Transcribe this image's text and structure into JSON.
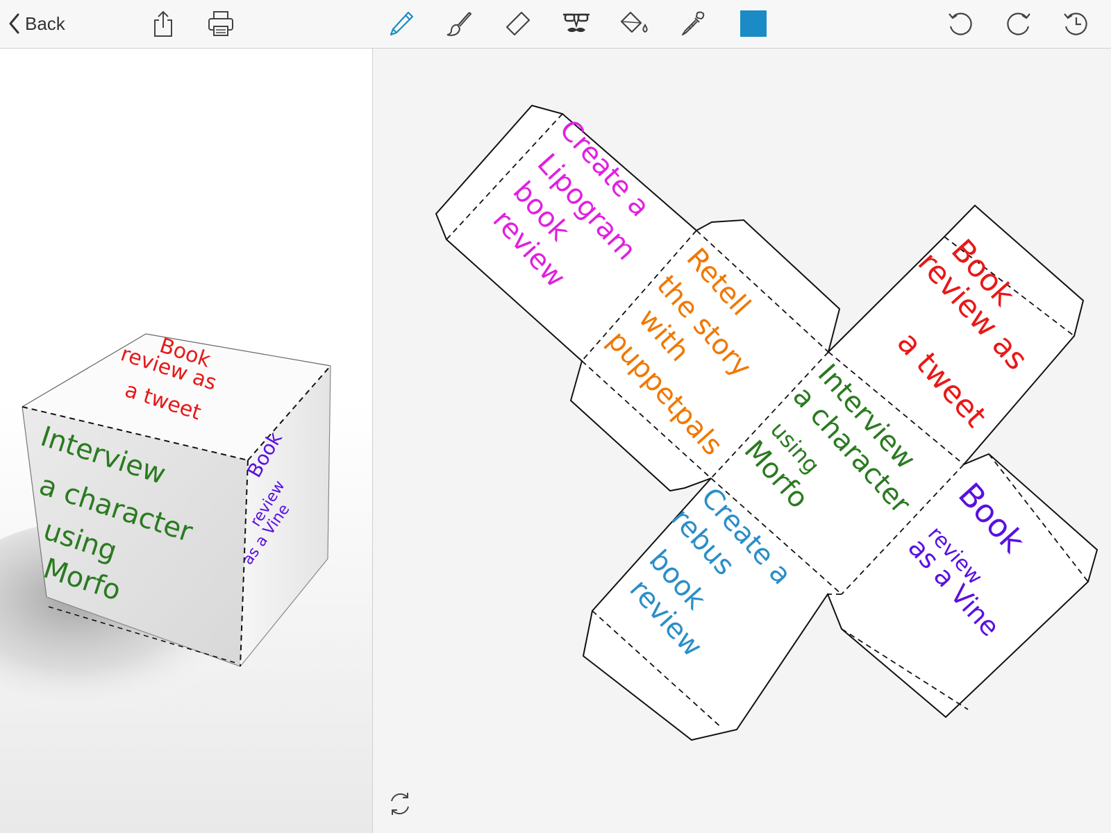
{
  "toolbar": {
    "back_label": "Back",
    "color_swatch": "#1a8bc5",
    "tools": [
      {
        "icon": "share-icon"
      },
      {
        "icon": "print-icon"
      },
      {
        "icon": "pencil-icon"
      },
      {
        "icon": "brush-icon"
      },
      {
        "icon": "eraser-icon"
      },
      {
        "icon": "mustache-icon"
      },
      {
        "icon": "paint-bucket-icon"
      },
      {
        "icon": "eyedropper-icon"
      },
      {
        "icon": "undo-icon"
      },
      {
        "icon": "redo-icon"
      },
      {
        "icon": "history-icon"
      }
    ]
  },
  "cube": {
    "top_face": [
      "Book",
      "review as",
      "a tweet"
    ],
    "front_face": [
      "Interview",
      "a character",
      "using",
      "Morfo"
    ],
    "side_face": [
      "Book",
      "review",
      "as a Vine"
    ]
  },
  "net": {
    "face_lipogram": [
      "Create a",
      "Lipogram",
      "book",
      "review"
    ],
    "face_retell": [
      "Retell",
      "the story",
      "with",
      "puppetpals"
    ],
    "face_tweet": [
      "Book",
      "review as",
      "a tweet"
    ],
    "face_interview": [
      "Interview",
      "a character",
      "using",
      "Morfo"
    ],
    "face_rebus": [
      "Create a",
      "rebus",
      "book",
      "review"
    ],
    "face_vine": [
      "Book",
      "review",
      "as a Vine"
    ]
  },
  "colors": {
    "magenta": "#e020e0",
    "orange": "#f07800",
    "red": "#e81818",
    "green": "#2a7a20",
    "blue": "#2a8ec8",
    "purple": "#5a10e0"
  }
}
